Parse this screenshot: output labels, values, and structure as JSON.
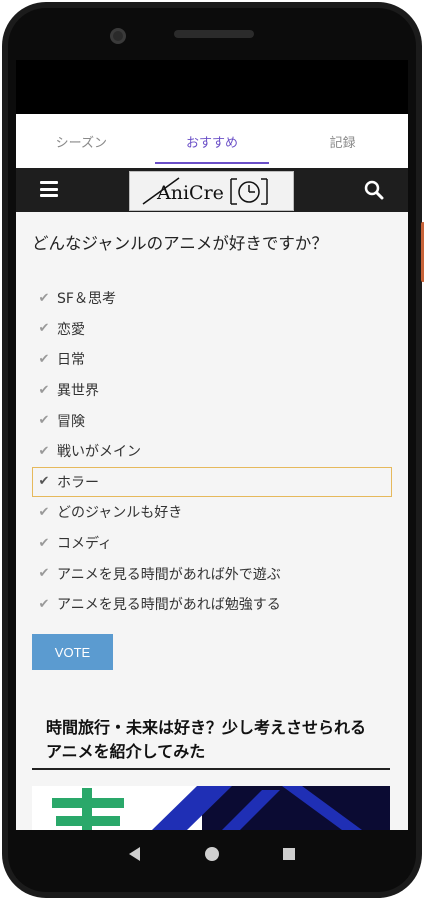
{
  "tabs": [
    {
      "label": "シーズン",
      "active": false
    },
    {
      "label": "おすすめ",
      "active": true
    },
    {
      "label": "記録",
      "active": false
    }
  ],
  "header": {
    "logo_text": "AniCre",
    "menu_icon": "hamburger-icon",
    "search_icon": "search-icon"
  },
  "poll": {
    "question": "どんなジャンルのアニメが好きですか？",
    "options": [
      {
        "label": "SF＆思考",
        "selected": false
      },
      {
        "label": "恋愛",
        "selected": false
      },
      {
        "label": "日常",
        "selected": false
      },
      {
        "label": "異世界",
        "selected": false
      },
      {
        "label": "冒険",
        "selected": false
      },
      {
        "label": "戦いがメイン",
        "selected": false
      },
      {
        "label": "ホラー",
        "selected": true
      },
      {
        "label": "どのジャンルも好き",
        "selected": false
      },
      {
        "label": "コメディ",
        "selected": false
      },
      {
        "label": "アニメを見る時間があれば外で遊ぶ",
        "selected": false
      },
      {
        "label": "アニメを見る時間があれば勉強する",
        "selected": false
      }
    ],
    "vote_label": "VOTE"
  },
  "article": {
    "title": "時間旅行・未来は好き？少し考えさせられるアニメを紹介してみた"
  },
  "colors": {
    "tab_accent": "#6a4fc7",
    "vote_button": "#5b9bd0",
    "selected_border": "#e6b95c",
    "appbar": "#1e1e1e"
  },
  "system_nav": {
    "back_icon": "back-triangle-icon",
    "home_icon": "home-circle-icon",
    "recents_icon": "recents-square-icon"
  }
}
